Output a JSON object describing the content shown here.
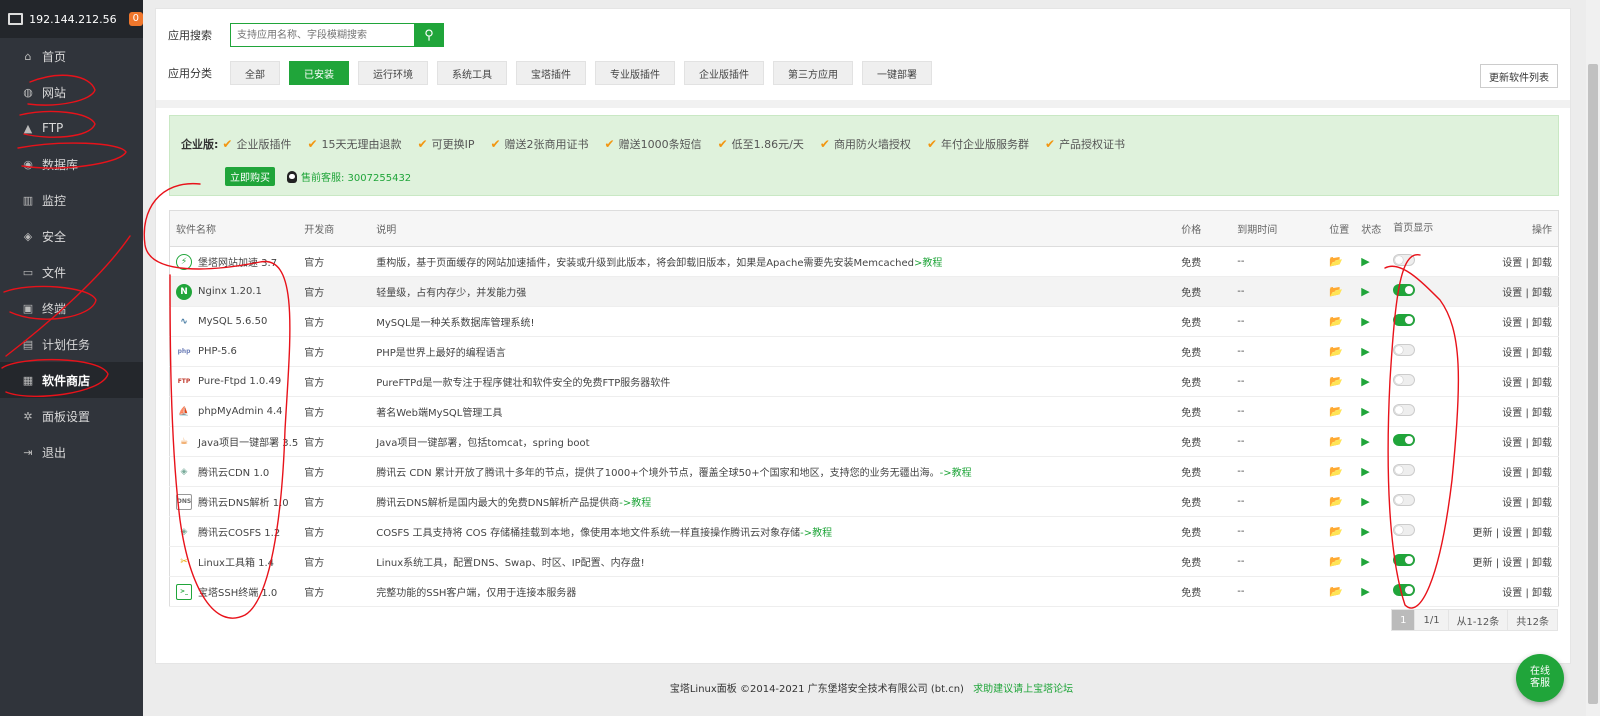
{
  "sidebar": {
    "ip": "192.144.212.56",
    "badge": "0",
    "items": [
      {
        "label": "首页",
        "icon": "home-icon"
      },
      {
        "label": "网站",
        "icon": "globe-icon"
      },
      {
        "label": "FTP",
        "icon": "ftp-icon"
      },
      {
        "label": "数据库",
        "icon": "database-icon"
      },
      {
        "label": "监控",
        "icon": "monitor-icon"
      },
      {
        "label": "安全",
        "icon": "shield-icon"
      },
      {
        "label": "文件",
        "icon": "folder-icon"
      },
      {
        "label": "终端",
        "icon": "terminal-icon"
      },
      {
        "label": "计划任务",
        "icon": "calendar-icon"
      },
      {
        "label": "软件商店",
        "icon": "grid-icon"
      },
      {
        "label": "面板设置",
        "icon": "gear-icon"
      },
      {
        "label": "退出",
        "icon": "logout-icon"
      }
    ]
  },
  "search": {
    "label": "应用搜索",
    "placeholder": "支持应用名称、字段模糊搜索"
  },
  "categories": {
    "label": "应用分类",
    "items": [
      "全部",
      "已安装",
      "运行环境",
      "系统工具",
      "宝塔插件",
      "专业版插件",
      "企业版插件",
      "第三方应用",
      "一键部署"
    ],
    "active": "已安装"
  },
  "update_button": "更新软件列表",
  "enterprise": {
    "title": "企业版:",
    "features": [
      "企业版插件",
      "15天无理由退款",
      "可更换IP",
      "赠送2张商用证书",
      "赠送1000条短信",
      "低至1.86元/天",
      "商用防火墙授权",
      "年付企业版服务群",
      "产品授权证书"
    ],
    "buy": "立即购买",
    "service": "售前客服: 3007255432"
  },
  "table": {
    "headers": [
      "软件名称",
      "开发商",
      "说明",
      "价格",
      "到期时间",
      "位置",
      "状态",
      "首页显示",
      "操作"
    ],
    "rows": [
      {
        "name": "堡塔网站加速 3.7",
        "dev": "官方",
        "desc": "重构版，基于页面缓存的网站加速插件，安装或升级到此版本，将会卸载旧版本，如果是Apache需要先安装Memcached",
        "link": ">教程",
        "price": "免费",
        "expire": "--",
        "on": false,
        "ops": "设置 | 卸载",
        "icon": "bolt"
      },
      {
        "name": "Nginx 1.20.1",
        "dev": "官方",
        "desc": "轻量级，占有内存少，并发能力强",
        "link": "",
        "price": "免费",
        "expire": "--",
        "on": true,
        "ops": "设置 | 卸载",
        "icon": "nginx"
      },
      {
        "name": "MySQL 5.6.50",
        "dev": "官方",
        "desc": "MySQL是一种关系数据库管理系统!",
        "link": "",
        "price": "免费",
        "expire": "--",
        "on": true,
        "ops": "设置 | 卸载",
        "icon": "mysql"
      },
      {
        "name": "PHP-5.6",
        "dev": "官方",
        "desc": "PHP是世界上最好的编程语言",
        "link": "",
        "price": "免费",
        "expire": "--",
        "on": false,
        "ops": "设置 | 卸载",
        "icon": "php"
      },
      {
        "name": "Pure-Ftpd 1.0.49",
        "dev": "官方",
        "desc": "PureFTPd是一款专注于程序健壮和软件安全的免费FTP服务器软件",
        "link": "",
        "price": "免费",
        "expire": "--",
        "on": false,
        "ops": "设置 | 卸载",
        "icon": "ftp"
      },
      {
        "name": "phpMyAdmin 4.4",
        "dev": "官方",
        "desc": "著名Web端MySQL管理工具",
        "link": "",
        "price": "免费",
        "expire": "--",
        "on": false,
        "ops": "设置 | 卸载",
        "icon": "pma"
      },
      {
        "name": "Java项目一键部署 3.5",
        "dev": "官方",
        "desc": "Java项目一键部署，包括tomcat，spring boot",
        "link": "",
        "price": "免费",
        "expire": "--",
        "on": true,
        "ops": "设置 | 卸载",
        "icon": "java"
      },
      {
        "name": "腾讯云CDN 1.0",
        "dev": "官方",
        "desc": "腾讯云 CDN 累计开放了腾讯十多年的节点，提供了1000+个境外节点，覆盖全球50+个国家和地区，支持您的业务无疆出海。",
        "link": "->教程",
        "price": "免费",
        "expire": "--",
        "on": false,
        "ops": "设置 | 卸载",
        "icon": "cdn"
      },
      {
        "name": "腾讯云DNS解析 1.0",
        "dev": "官方",
        "desc": "腾讯云DNS解析是国内最大的免费DNS解析产品提供商",
        "link": "->教程",
        "price": "免费",
        "expire": "--",
        "on": false,
        "ops": "设置 | 卸载",
        "icon": "dns"
      },
      {
        "name": "腾讯云COSFS 1.2",
        "dev": "官方",
        "desc": "COSFS 工具支持将 COS 存储桶挂载到本地，像使用本地文件系统一样直接操作腾讯云对象存储",
        "link": "->教程",
        "price": "免费",
        "expire": "--",
        "on": false,
        "ops": "更新 | 设置 | 卸载",
        "icon": "cos"
      },
      {
        "name": "Linux工具箱 1.4",
        "dev": "官方",
        "desc": "Linux系统工具，配置DNS、Swap、时区、IP配置、内存盘!",
        "link": "",
        "price": "免费",
        "expire": "--",
        "on": true,
        "ops": "更新 | 设置 | 卸载",
        "icon": "tools"
      },
      {
        "name": "宝塔SSH终端 1.0",
        "dev": "官方",
        "desc": "完整功能的SSH客户端，仅用于连接本服务器",
        "link": "",
        "price": "免费",
        "expire": "--",
        "on": true,
        "ops": "设置 | 卸载",
        "icon": "ssh"
      }
    ]
  },
  "pager": {
    "page": "1",
    "pages": "1/1",
    "range": "从1-12条",
    "total": "共12条"
  },
  "footer": {
    "text": "宝塔Linux面板 ©2014-2021 广东堡塔安全技术有限公司 (bt.cn)",
    "link": "求助建议请上宝塔论坛"
  },
  "online_service": "在线客服",
  "colors": {
    "accent": "#20a53a",
    "sidebar": "#30343b",
    "annotation": "#ff0000"
  }
}
